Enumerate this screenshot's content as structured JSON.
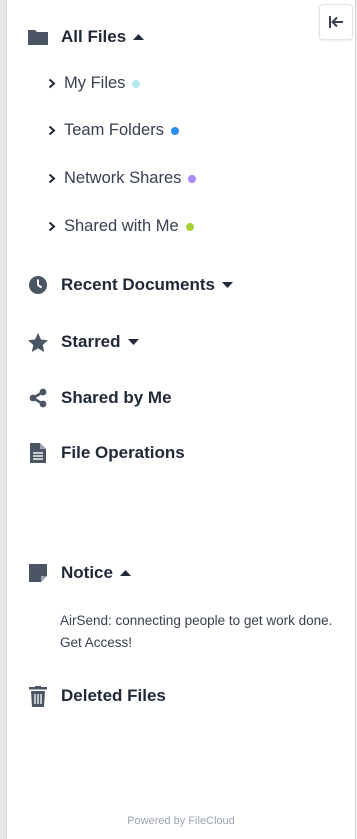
{
  "sidebar": {
    "all_files": {
      "label": "All Files",
      "icon": "folder-icon",
      "expanded": true
    },
    "sub_items": [
      {
        "label": "My Files",
        "dot_color": "#b7e7ea"
      },
      {
        "label": "Team Folders",
        "dot_color": "#2d8cf0"
      },
      {
        "label": "Network Shares",
        "dot_color": "#a78bfa"
      },
      {
        "label": "Shared with Me",
        "dot_color": "#a3d134"
      }
    ],
    "recent_documents": {
      "label": "Recent Documents",
      "icon": "clock-icon"
    },
    "starred": {
      "label": "Starred",
      "icon": "star-icon"
    },
    "shared_by_me": {
      "label": "Shared by Me",
      "icon": "share-icon"
    },
    "file_operations": {
      "label": "File Operations",
      "icon": "document-icon"
    },
    "notice": {
      "label": "Notice",
      "icon": "note-icon",
      "text": "AirSend: connecting people to get work done. Get Access!"
    },
    "deleted_files": {
      "label": "Deleted Files",
      "icon": "trash-icon"
    },
    "powered_by": "Powered by FileCloud"
  },
  "colors": {
    "icon": "#4b5563",
    "text": "#1f2937",
    "muted": "#9ca3af"
  }
}
